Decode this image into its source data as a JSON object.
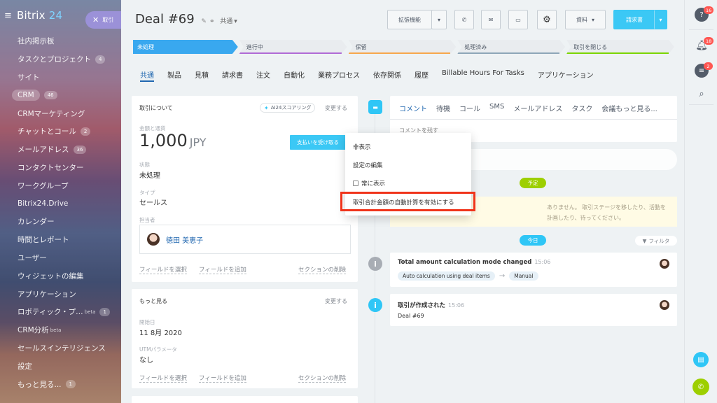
{
  "sidebar": {
    "logo": "Bitrix",
    "logo_num": "24",
    "deal_pill": "取引",
    "items": [
      {
        "label": "社内掲示板",
        "count": ""
      },
      {
        "label": "タスクとプロジェクト",
        "count": "4"
      },
      {
        "label": "サイト",
        "count": ""
      },
      {
        "label": "CRM",
        "count": "46"
      },
      {
        "label": "CRMマーケティング",
        "count": ""
      },
      {
        "label": "チャットとコール",
        "count": "2"
      },
      {
        "label": "メールアドレス",
        "count": "36"
      },
      {
        "label": "コンタクトセンター",
        "count": ""
      },
      {
        "label": "ワークグループ",
        "count": ""
      },
      {
        "label": "Bitrix24.Drive",
        "count": ""
      },
      {
        "label": "カレンダー",
        "count": ""
      },
      {
        "label": "時間とレポート",
        "count": ""
      },
      {
        "label": "ユーザー",
        "count": ""
      },
      {
        "label": "ウィジェットの編集",
        "count": ""
      },
      {
        "label": "アプリケーション",
        "count": ""
      },
      {
        "label": "ロボティック・プ…",
        "count": "1",
        "sup": "beta"
      },
      {
        "label": "CRM分析",
        "count": "",
        "sup": "beta"
      },
      {
        "label": "セールスインテリジェンス",
        "count": ""
      },
      {
        "label": "設定",
        "count": ""
      },
      {
        "label": "もっと見る...",
        "count": "1"
      }
    ]
  },
  "header": {
    "title": "Deal  #69",
    "shared": "共通",
    "btn_extend": "拡張機能",
    "btn_docs": "資料",
    "btn_invoice": "請求書"
  },
  "stages": [
    {
      "label": "未処理",
      "color": "#39a8ef"
    },
    {
      "label": "進行中",
      "color": "#b06ad5"
    },
    {
      "label": "保留",
      "color": "#f7a74c"
    },
    {
      "label": "処理済み",
      "color": "#8ea6b8"
    },
    {
      "label": "取引を閉じる",
      "color": "#7bd500"
    }
  ],
  "tabs": [
    "共通",
    "製品",
    "見積",
    "請求書",
    "注文",
    "自動化",
    "業務プロセス",
    "依存関係",
    "履歴",
    "Billable Hours For Tasks",
    "アプリケーション"
  ],
  "about": {
    "heading": "取引について",
    "ai_chip": "AI24スコアリング",
    "change": "変更する",
    "amount_label": "金額と通貨",
    "amount": "1,000",
    "currency": "JPY",
    "pay_button": "支払いを受け取る",
    "status_label": "状態",
    "status": "未処理",
    "type_label": "タイプ",
    "type": "セールス",
    "resp_label": "担当者",
    "resp_name": "徳田 美恵子",
    "select_field": "フィールドを選択",
    "add_field": "フィールドを追加",
    "delete_section": "セクションの削除"
  },
  "more": {
    "heading": "もっと見る",
    "change": "変更する",
    "start_label": "開始日",
    "start": "11 8月 2020",
    "utm_label": "UTMパラメータ",
    "utm": "なし",
    "select_field": "フィールドを選択",
    "add_field": "フィールドを追加",
    "delete_section": "セクションの削除"
  },
  "timeline": {
    "tabs": [
      "コメント",
      "待機",
      "コール",
      "SMS",
      "メールアドレス",
      "タスク",
      "会議もっと見る..."
    ],
    "comment_placeholder": "コメントを残す",
    "planned": "予定",
    "info_text": "ありません。 取引ステージを移したり、活動を計画したり、待ってください。",
    "today": "今日",
    "filter": "フィルタ",
    "event1_title": "Total amount calculation mode changed",
    "event1_time": "15:06",
    "event1_from": "Auto calculation using deal items",
    "event1_to": "Manual",
    "event2_title": "取引が作成された",
    "event2_time": "15:06",
    "event2_body": "Deal #69"
  },
  "context_menu": {
    "items": [
      "非表示",
      "設定の編集",
      "常に表示",
      "取引合計金額の自動計算を有効にする"
    ]
  },
  "rail": {
    "help_badge": "16",
    "bell_badge": "18",
    "chat_badge": "2"
  }
}
